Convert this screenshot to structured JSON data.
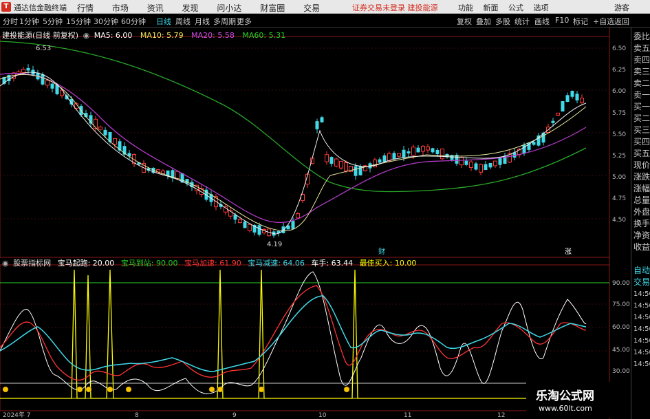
{
  "window": {
    "app_name": "通达信金融终端",
    "menu": [
      "行情",
      "市场",
      "资讯",
      "发现",
      "问小达",
      "财富圈",
      "交易"
    ],
    "alert": "证券交易未登录  建投能源",
    "right_buttons": [
      "功能",
      "新面",
      "公式",
      "选项"
    ],
    "guest_label": "游客"
  },
  "toolbar": {
    "timeframes": [
      "分时",
      "1分钟",
      "5分钟",
      "15分钟",
      "30分钟",
      "60分钟",
      "日线",
      "周线",
      "月线",
      "多周期",
      "更多"
    ],
    "active_timeframe": "日线",
    "tools": [
      "复权",
      "叠加",
      "多股",
      "统计",
      "画线",
      "F10",
      "标记",
      "+自选",
      "返回"
    ]
  },
  "main_legend": {
    "title": "建投能源(日线 前复权)",
    "ma5": "MA5: 6.00",
    "ma10": "MA10: 5.79",
    "ma20": "MA20: 5.58",
    "ma60": "MA60: 5.31",
    "high_label": "6.53",
    "low_label": "4.19",
    "markers": [
      "财",
      "涨"
    ]
  },
  "price_axis": [
    "6.50",
    "6.25",
    "6.00",
    "5.75",
    "5.50",
    "5.25",
    "5.00",
    "4.75",
    "4.50"
  ],
  "indicator": {
    "name": "股票指标网",
    "items": [
      {
        "label": "宝马起跑: 20.00",
        "color": "#ffffff"
      },
      {
        "label": "宝马到站: 90.00",
        "color": "#27d227"
      },
      {
        "label": "宝马加速: 61.90",
        "color": "#ff3333"
      },
      {
        "label": "宝马减速: 64.06",
        "color": "#3fd9e8"
      },
      {
        "label": "车手: 63.44",
        "color": "#ffffff"
      },
      {
        "label": "最佳买入: 10.00",
        "color": "#ffff00"
      }
    ],
    "axis": [
      "90.00",
      "75.00",
      "60.00",
      "45.00",
      "30.00"
    ]
  },
  "date_axis": [
    "2024年 7",
    "8",
    "9",
    "10",
    "11",
    "12"
  ],
  "right_panel": [
    "委比",
    "卖五",
    "卖四",
    "卖三",
    "卖二",
    "卖一",
    "买一",
    "买二",
    "买三",
    "买四",
    "买五",
    "现价",
    "涨跌",
    "涨幅",
    "总量",
    "外盘",
    "换手",
    "净资",
    "收益",
    "自动",
    "交易"
  ],
  "right_panel_times": [
    "14:50",
    "14:50",
    "14:50",
    "14:50",
    "14:50",
    "14:50",
    "14:50"
  ],
  "watermark": {
    "line1": "乐淘公式网",
    "line2": "www.60lt.com"
  }
}
